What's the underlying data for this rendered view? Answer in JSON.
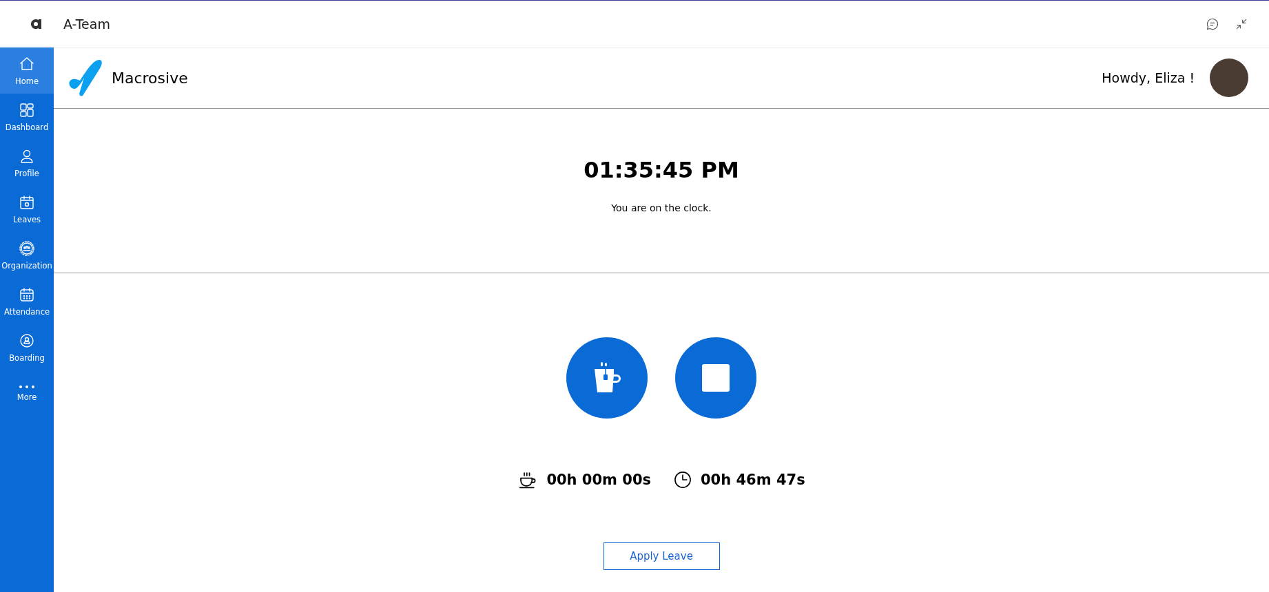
{
  "app_bar": {
    "title": "A-Team"
  },
  "sidebar": {
    "items": [
      {
        "kind": "home",
        "label": "Home",
        "selected": true
      },
      {
        "kind": "dashboard",
        "label": "Dashboard",
        "selected": false
      },
      {
        "kind": "profile",
        "label": "Profile",
        "selected": false
      },
      {
        "kind": "leaves",
        "label": "Leaves",
        "selected": false
      },
      {
        "kind": "organization",
        "label": "Organization",
        "selected": false
      },
      {
        "kind": "attendance",
        "label": "Attendance",
        "selected": false
      },
      {
        "kind": "boarding",
        "label": "Boarding",
        "selected": false
      },
      {
        "kind": "more",
        "label": "More",
        "selected": false
      }
    ]
  },
  "header": {
    "brand": "Macrosive",
    "greeting": "Howdy, Eliza !"
  },
  "clock": {
    "time": "01:35:45 PM",
    "status": "You are on the clock."
  },
  "timers": [
    {
      "kind": "break",
      "value": "00h 00m 00s"
    },
    {
      "kind": "work",
      "value": "00h 46m 47s"
    }
  ],
  "action_button": "Apply Leave"
}
